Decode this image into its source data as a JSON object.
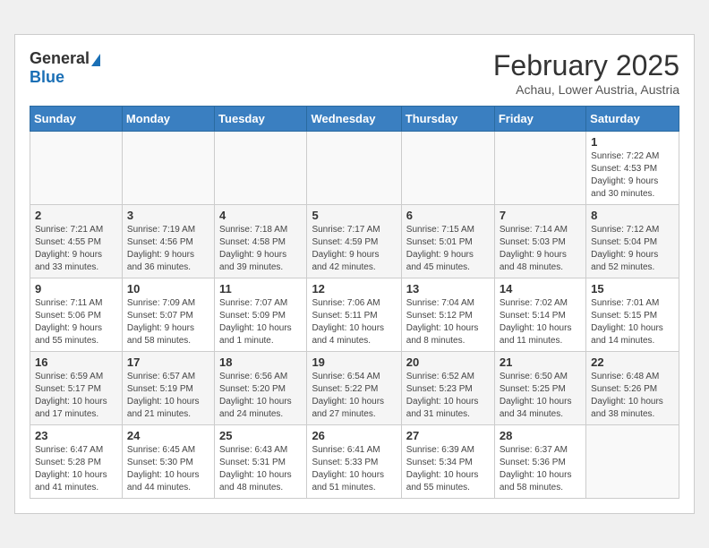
{
  "header": {
    "logo_general": "General",
    "logo_blue": "Blue",
    "month_year": "February 2025",
    "location": "Achau, Lower Austria, Austria"
  },
  "weekdays": [
    "Sunday",
    "Monday",
    "Tuesday",
    "Wednesday",
    "Thursday",
    "Friday",
    "Saturday"
  ],
  "weeks": [
    [
      {
        "day": "",
        "info": ""
      },
      {
        "day": "",
        "info": ""
      },
      {
        "day": "",
        "info": ""
      },
      {
        "day": "",
        "info": ""
      },
      {
        "day": "",
        "info": ""
      },
      {
        "day": "",
        "info": ""
      },
      {
        "day": "1",
        "info": "Sunrise: 7:22 AM\nSunset: 4:53 PM\nDaylight: 9 hours and 30 minutes."
      }
    ],
    [
      {
        "day": "2",
        "info": "Sunrise: 7:21 AM\nSunset: 4:55 PM\nDaylight: 9 hours and 33 minutes."
      },
      {
        "day": "3",
        "info": "Sunrise: 7:19 AM\nSunset: 4:56 PM\nDaylight: 9 hours and 36 minutes."
      },
      {
        "day": "4",
        "info": "Sunrise: 7:18 AM\nSunset: 4:58 PM\nDaylight: 9 hours and 39 minutes."
      },
      {
        "day": "5",
        "info": "Sunrise: 7:17 AM\nSunset: 4:59 PM\nDaylight: 9 hours and 42 minutes."
      },
      {
        "day": "6",
        "info": "Sunrise: 7:15 AM\nSunset: 5:01 PM\nDaylight: 9 hours and 45 minutes."
      },
      {
        "day": "7",
        "info": "Sunrise: 7:14 AM\nSunset: 5:03 PM\nDaylight: 9 hours and 48 minutes."
      },
      {
        "day": "8",
        "info": "Sunrise: 7:12 AM\nSunset: 5:04 PM\nDaylight: 9 hours and 52 minutes."
      }
    ],
    [
      {
        "day": "9",
        "info": "Sunrise: 7:11 AM\nSunset: 5:06 PM\nDaylight: 9 hours and 55 minutes."
      },
      {
        "day": "10",
        "info": "Sunrise: 7:09 AM\nSunset: 5:07 PM\nDaylight: 9 hours and 58 minutes."
      },
      {
        "day": "11",
        "info": "Sunrise: 7:07 AM\nSunset: 5:09 PM\nDaylight: 10 hours and 1 minute."
      },
      {
        "day": "12",
        "info": "Sunrise: 7:06 AM\nSunset: 5:11 PM\nDaylight: 10 hours and 4 minutes."
      },
      {
        "day": "13",
        "info": "Sunrise: 7:04 AM\nSunset: 5:12 PM\nDaylight: 10 hours and 8 minutes."
      },
      {
        "day": "14",
        "info": "Sunrise: 7:02 AM\nSunset: 5:14 PM\nDaylight: 10 hours and 11 minutes."
      },
      {
        "day": "15",
        "info": "Sunrise: 7:01 AM\nSunset: 5:15 PM\nDaylight: 10 hours and 14 minutes."
      }
    ],
    [
      {
        "day": "16",
        "info": "Sunrise: 6:59 AM\nSunset: 5:17 PM\nDaylight: 10 hours and 17 minutes."
      },
      {
        "day": "17",
        "info": "Sunrise: 6:57 AM\nSunset: 5:19 PM\nDaylight: 10 hours and 21 minutes."
      },
      {
        "day": "18",
        "info": "Sunrise: 6:56 AM\nSunset: 5:20 PM\nDaylight: 10 hours and 24 minutes."
      },
      {
        "day": "19",
        "info": "Sunrise: 6:54 AM\nSunset: 5:22 PM\nDaylight: 10 hours and 27 minutes."
      },
      {
        "day": "20",
        "info": "Sunrise: 6:52 AM\nSunset: 5:23 PM\nDaylight: 10 hours and 31 minutes."
      },
      {
        "day": "21",
        "info": "Sunrise: 6:50 AM\nSunset: 5:25 PM\nDaylight: 10 hours and 34 minutes."
      },
      {
        "day": "22",
        "info": "Sunrise: 6:48 AM\nSunset: 5:26 PM\nDaylight: 10 hours and 38 minutes."
      }
    ],
    [
      {
        "day": "23",
        "info": "Sunrise: 6:47 AM\nSunset: 5:28 PM\nDaylight: 10 hours and 41 minutes."
      },
      {
        "day": "24",
        "info": "Sunrise: 6:45 AM\nSunset: 5:30 PM\nDaylight: 10 hours and 44 minutes."
      },
      {
        "day": "25",
        "info": "Sunrise: 6:43 AM\nSunset: 5:31 PM\nDaylight: 10 hours and 48 minutes."
      },
      {
        "day": "26",
        "info": "Sunrise: 6:41 AM\nSunset: 5:33 PM\nDaylight: 10 hours and 51 minutes."
      },
      {
        "day": "27",
        "info": "Sunrise: 6:39 AM\nSunset: 5:34 PM\nDaylight: 10 hours and 55 minutes."
      },
      {
        "day": "28",
        "info": "Sunrise: 6:37 AM\nSunset: 5:36 PM\nDaylight: 10 hours and 58 minutes."
      },
      {
        "day": "",
        "info": ""
      }
    ]
  ]
}
